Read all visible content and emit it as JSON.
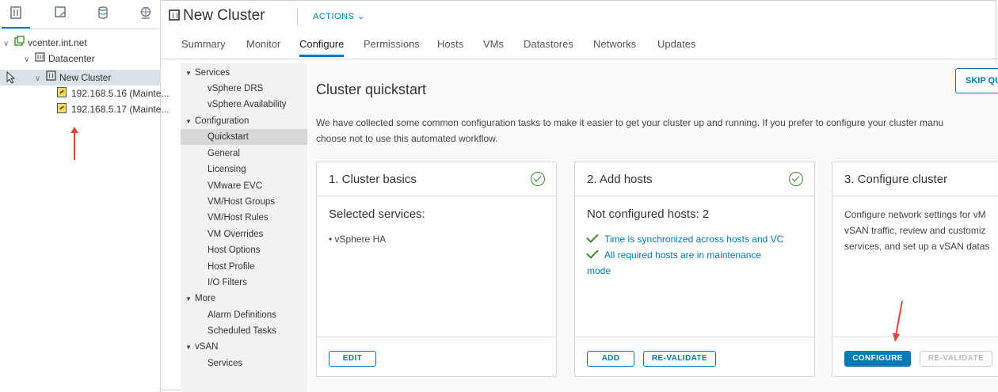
{
  "navigator": {
    "tabs": [
      "hosts-clusters-icon",
      "vms-templates-icon",
      "storage-icon",
      "networking-icon"
    ],
    "tree": {
      "vcenter": "vcenter.int.net",
      "datacenter": "Datacenter",
      "cluster": "New Cluster",
      "hosts": [
        "192.168.5.16 (Mainte...",
        "192.168.5.17 (Mainte..."
      ]
    }
  },
  "header": {
    "title": "New Cluster",
    "actions_label": "ACTIONS ⌄"
  },
  "tabs": [
    "Summary",
    "Monitor",
    "Configure",
    "Permissions",
    "Hosts",
    "VMs",
    "Datastores",
    "Networks",
    "Updates"
  ],
  "active_tab": "Configure",
  "config_nav": {
    "services": {
      "label": "Services",
      "items": [
        "vSphere DRS",
        "vSphere Availability"
      ]
    },
    "configuration": {
      "label": "Configuration",
      "items": [
        "Quickstart",
        "General",
        "Licensing",
        "VMware EVC",
        "VM/Host Groups",
        "VM/Host Rules",
        "VM Overrides",
        "Host Options",
        "Host Profile",
        "I/O Filters"
      ]
    },
    "more": {
      "label": "More",
      "items": [
        "Alarm Definitions",
        "Scheduled Tasks"
      ]
    },
    "vsan": {
      "label": "vSAN",
      "items": [
        "Services"
      ]
    },
    "selected": "Quickstart"
  },
  "quickstart": {
    "title": "Cluster quickstart",
    "skip_label": "SKIP QU",
    "description_line1": "We have collected some common configuration tasks to make it easier to get your cluster up and running. If you prefer to configure your cluster manu",
    "description_line2": "choose not to use this automated workflow.",
    "cards": [
      {
        "title": "1. Cluster basics",
        "subtitle": "Selected services:",
        "text": "• vSphere HA",
        "buttons": [
          "EDIT"
        ]
      },
      {
        "title": "2. Add hosts",
        "subtitle": "Not configured hosts: 2",
        "checks": [
          "Time is synchronized across hosts and VC",
          "All required hosts are in maintenance",
          "mode"
        ],
        "buttons": [
          "ADD",
          "RE-VALIDATE"
        ]
      },
      {
        "title": "3. Configure cluster",
        "text_lines": [
          "Configure network settings for vM",
          "vSAN traffic, review and customiz",
          "services, and set up a vSAN datas"
        ],
        "buttons": [
          "CONFIGURE",
          "RE-VALIDATE"
        ]
      }
    ]
  },
  "colors": {
    "accent": "#0079b8",
    "success": "#3c8a2e",
    "annotation": "#e0443e"
  }
}
